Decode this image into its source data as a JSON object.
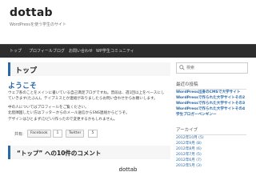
{
  "header": {
    "site_title": "dottab",
    "site_description": "WordPressを使う学生のサイト"
  },
  "nav": {
    "items": [
      "トップ",
      "プロフィール",
      "ブログ",
      "お問い合わせ",
      "WP学生コミュニティ"
    ]
  },
  "main": {
    "page_title": "トップ",
    "welcome_heading": "ようこそ",
    "paragraphs": [
      "ウェブ系のことをメインに書いている自己満足ブログですね。普段は、週1回以上をベースにし",
      "ていきます(たぶん)。テイプミスとか連絡がありましたらお問い合わせからお願いします。",
      "中の人についてはプロフィールをご覧ください。",
      "北陸隣国したい方はフッターからのメール送信からSNS連絡からどうぞ。",
      "デザインはひとまず(ひどい)作ったので変更するかもしれません。"
    ],
    "share": {
      "label": "共有:",
      "facebook_label": "Facebook",
      "facebook_count": "1",
      "twitter_label": "Twitter",
      "twitter_count": "5"
    },
    "comments_title": "“トップ” への10件のコメント"
  },
  "sidebar": {
    "search_placeholder": "検索",
    "recent_heading": "最近の投稿",
    "recent_posts": [
      "WordPress出身のCMSで大学サイト",
      "WordPressで作られた大学サイトその2",
      "WordPressで作られた大学サイトその3",
      "WordPressで作られた大学サイトその4",
      "学生ブロガーペンギンー"
    ],
    "archive_heading": "アーカイブ",
    "archives": [
      "2012年10月 (5)",
      "2012年9月 (8)",
      "2012年8月 (6)",
      "2012年7月 (5)",
      "2012年6月 (7)",
      "2012年5月 (3)"
    ]
  },
  "caption": "dottab"
}
